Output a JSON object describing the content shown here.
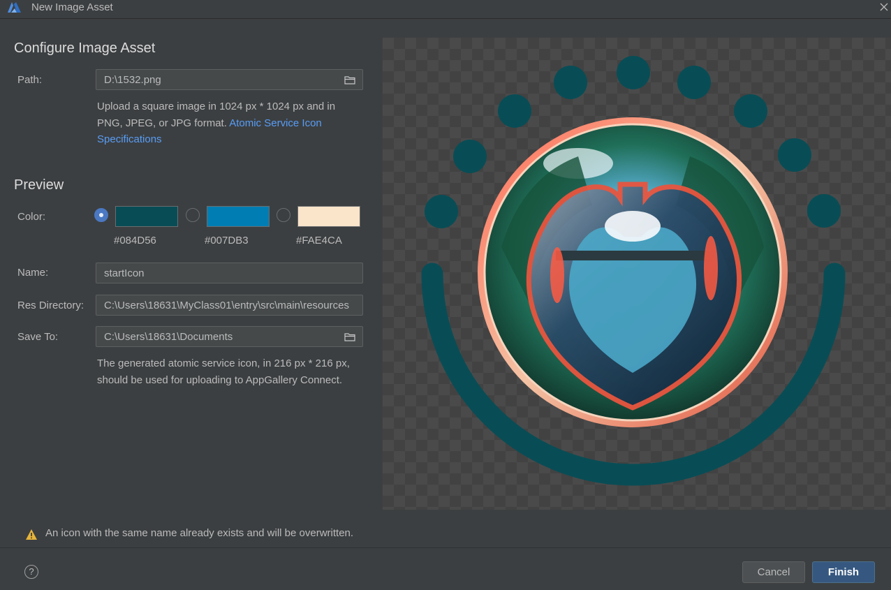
{
  "window": {
    "title": "New Image Asset"
  },
  "configure": {
    "heading": "Configure Image Asset",
    "path_label": "Path:",
    "path_value": "D:\\1532.png",
    "help_text": "Upload a square image in 1024 px * 1024 px and in PNG, JPEG, or JPG format. ",
    "help_link": "Atomic Service Icon Specifications"
  },
  "preview": {
    "heading": "Preview",
    "color_label": "Color:",
    "colors": [
      {
        "hex": "#084D56",
        "selected": true
      },
      {
        "hex": "#007DB3",
        "selected": false
      },
      {
        "hex": "#FAE4CA",
        "selected": false
      }
    ],
    "name_label": "Name:",
    "name_value": "startIcon",
    "resdir_label": "Res Directory:",
    "resdir_value": "C:\\Users\\18631\\MyClass01\\entry\\src\\main\\resources",
    "saveto_label": "Save To:",
    "saveto_value": "C:\\Users\\18631\\Documents",
    "save_help": "The generated atomic service icon, in 216 px * 216 px, should be used for uploading to AppGallery Connect."
  },
  "warning": {
    "text": "An icon with the same name already exists and will be overwritten."
  },
  "footer": {
    "help_glyph": "?",
    "cancel_label": "Cancel",
    "finish_label": "Finish"
  },
  "icons": {
    "logo": "harmony-logo-icon",
    "close": "close-icon",
    "folder": "folder-icon",
    "warning": "warning-icon",
    "help": "help-icon"
  },
  "theme": {
    "accent": "#084D56",
    "link": "#589DF6",
    "finish": "#365880"
  }
}
